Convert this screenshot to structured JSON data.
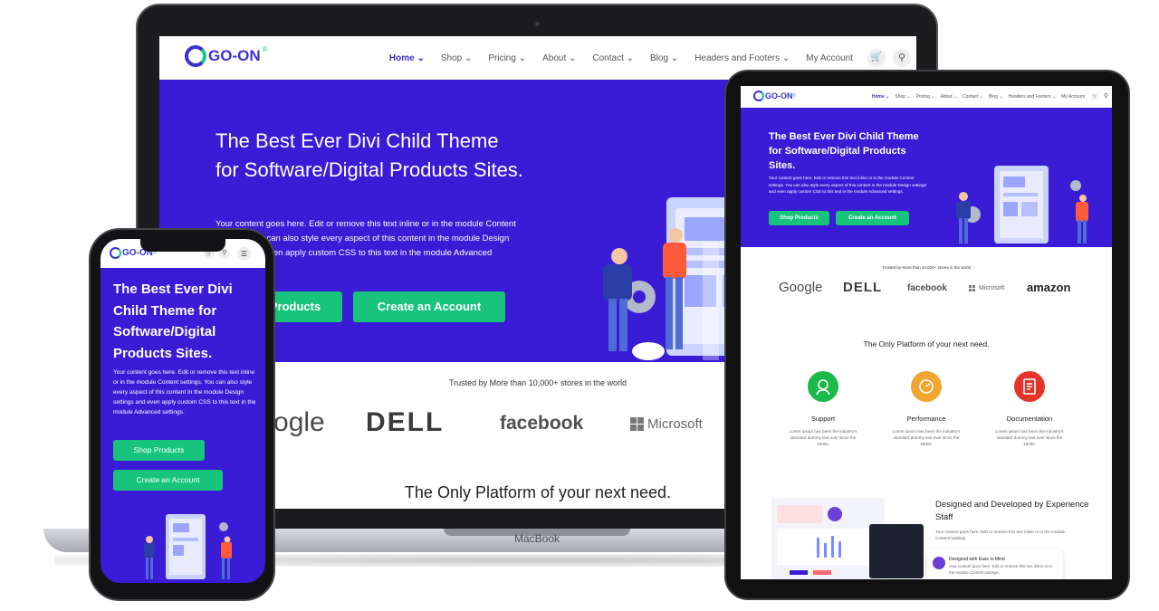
{
  "brand": {
    "logo_text": "GO-ON",
    "trademark": "®"
  },
  "colors": {
    "primary": "#3a1bd6",
    "accent": "#18c47c",
    "logo": "#3a2fd0"
  },
  "desktop": {
    "nav": [
      {
        "label": "Home ⌄"
      },
      {
        "label": "Shop ⌄"
      },
      {
        "label": "Pricing ⌄"
      },
      {
        "label": "About ⌄"
      },
      {
        "label": "Contact ⌄"
      },
      {
        "label": "Blog ⌄"
      },
      {
        "label": "Headers and Footers ⌄"
      },
      {
        "label": "My Account"
      }
    ],
    "hero": {
      "title": "The Best Ever Divi Child Theme for Software/Digital Products Sites.",
      "body": "Your content goes here. Edit or remove this text inline or in the module Content settings. You can also style every aspect of this content in the module Design settings and even apply custom CSS to this text in the module Advanced settings.",
      "primary_button": "Shop Products",
      "secondary_button": "Create an Account"
    },
    "trusted": "Trusted by More than 10,000+ stores in the world",
    "brands": {
      "google": "Google",
      "dell": "DELL",
      "facebook": "facebook",
      "microsoft": "Microsoft"
    },
    "only_platform": "The Only Platform of your next need.",
    "device_label": "MacBook"
  },
  "tablet": {
    "nav": [
      {
        "label": "Home ⌄"
      },
      {
        "label": "Shop ⌄"
      },
      {
        "label": "Pricing ⌄"
      },
      {
        "label": "About ⌄"
      },
      {
        "label": "Contact ⌄"
      },
      {
        "label": "Blog ⌄"
      },
      {
        "label": "Headers and Footers ⌄"
      },
      {
        "label": "My Account"
      }
    ],
    "hero": {
      "title": "The Best Ever Divi Child Theme for Software/Digital Products Sites.",
      "body": "Your content goes here. Edit or remove this text inline or in the module Content settings. You can also style every aspect of this content in the module Design settings and even apply custom CSS to this text in the module Advanced settings.",
      "primary_button": "Shop Products",
      "secondary_button": "Create an Account"
    },
    "trusted": "Trusted by More than 10,000+ stores in the world",
    "brands": {
      "google": "Google",
      "dell": "DELL",
      "facebook": "facebook",
      "microsoft": "Microsoft",
      "amazon": "amazon"
    },
    "only_platform": "The Only Platform of your next need.",
    "features": [
      {
        "title": "Support",
        "desc": "Lorem ipsum has been the industry's standard dummy text ever since the 1500s.",
        "color": "#1bb84a",
        "icon": "support-icon"
      },
      {
        "title": "Performance",
        "desc": "Lorem ipsum has been the industry's standard dummy text ever since the 1500s.",
        "color": "#f2a531",
        "icon": "performance-icon"
      },
      {
        "title": "Documentation",
        "desc": "Lorem ipsum has been the industry's standard dummy text ever since the 1500s.",
        "color": "#e5352b",
        "icon": "documentation-icon"
      }
    ],
    "designed": {
      "title": "Designed and Developed by Experience Staff",
      "body": "Your content goes here. Edit or remove this text inline or in the module Content settings.",
      "card_title": "Designed with Ease in Mind",
      "card_body": "Your content goes here. Edit or remove this text inline or in the module Content settings."
    }
  },
  "phone": {
    "hero": {
      "title": "The Best Ever Divi Child Theme for Software/Digital Products Sites.",
      "body": "Your content goes here. Edit or remove this text inline or in the module Content settings. You can also style every aspect of this content in the module Design settings and even apply custom CSS to this text in the module Advanced settings.",
      "primary_button": "Shop Products",
      "secondary_button": "Create an Account"
    }
  }
}
